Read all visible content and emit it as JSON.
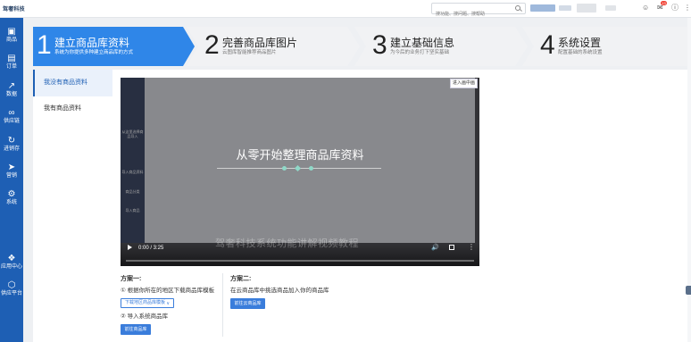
{
  "app": {
    "logo": "驾奢科技"
  },
  "search": {
    "placeholder": "搜功能、搜问题、搜帮助"
  },
  "topbar": {
    "notif_count": "13"
  },
  "sidebar": {
    "items": [
      {
        "label": "商品",
        "icon": "package-icon"
      },
      {
        "label": "订单",
        "icon": "clipboard-icon"
      },
      {
        "label": "数据",
        "icon": "trend-icon"
      },
      {
        "label": "供应链",
        "icon": "link-icon"
      },
      {
        "label": "进销存",
        "icon": "refresh-icon"
      },
      {
        "label": "营销",
        "icon": "tag-icon"
      },
      {
        "label": "系统",
        "icon": "gear-icon"
      },
      {
        "label": "应用中心",
        "icon": "apps-icon"
      },
      {
        "label": "供应平台",
        "icon": "hexagon-icon"
      }
    ]
  },
  "steps": [
    {
      "num": "1",
      "title": "建立商品库资料",
      "sub": "系统为你提供多种建立商品库的方式"
    },
    {
      "num": "2",
      "title": "完善商品库图片",
      "sub": "云图库智能推荐商品图片"
    },
    {
      "num": "3",
      "title": "建立基础信息",
      "sub": "为今后的业务打下坚实基础"
    },
    {
      "num": "4",
      "title": "系统设置",
      "sub": "配置基础的系统设置"
    }
  ],
  "left_menu": [
    {
      "label": "我没有商品资料"
    },
    {
      "label": "我有商品资料"
    }
  ],
  "video": {
    "caption": "从零开始整理商品库资料",
    "time": "0:00 / 3:25",
    "watermark_title": "驾奢科技系统功能讲解视频教程",
    "share_label": "进入画中画",
    "side_labels": [
      "从这里选择商品导入",
      "导入商品资料",
      "商品分类",
      "导入商品"
    ]
  },
  "plan_a": {
    "title": "方案一:",
    "step1": "① 根据你所在的地区下载商品库模板",
    "download_label": "下载地区商品库模板",
    "step2": "② 导入系统商品库",
    "go_label": "前往商品库"
  },
  "plan_b": {
    "title": "方案二:",
    "desc": "在云商品库中挑选商品加入你的商品库",
    "go_label": "前往云商品库"
  }
}
